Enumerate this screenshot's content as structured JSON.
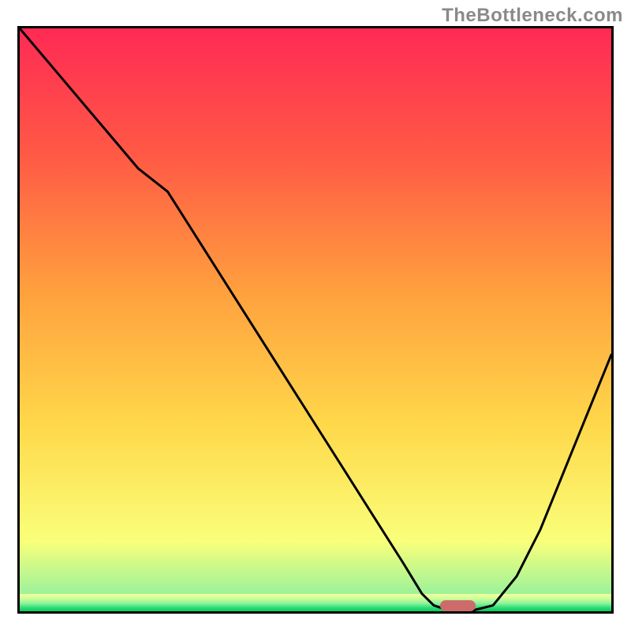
{
  "watermark": "TheBottleneck.com",
  "colors": {
    "border": "#000000",
    "curve": "#000000",
    "marker": "#cc6b6a",
    "gradient_top": "#ff2a55",
    "gradient_mid1": "#ff6a3e",
    "gradient_mid2": "#ffb73e",
    "gradient_mid3": "#ffe24a",
    "gradient_bottom": "#f7ff8a",
    "green": "#07c85a"
  },
  "chart_data": {
    "type": "line",
    "title": "",
    "xlabel": "",
    "ylabel": "",
    "xlim": [
      0,
      100
    ],
    "ylim": [
      0,
      100
    ],
    "series": [
      {
        "name": "bottleneck-curve",
        "x": [
          0,
          5,
          10,
          15,
          20,
          25,
          30,
          35,
          40,
          45,
          50,
          55,
          60,
          65,
          68,
          70,
          73,
          76,
          80,
          84,
          88,
          92,
          96,
          100
        ],
        "y": [
          100,
          94,
          88,
          82,
          76,
          72,
          64,
          56,
          48,
          40,
          32,
          24,
          16,
          8,
          3,
          1,
          0,
          0,
          1,
          6,
          14,
          24,
          34,
          44
        ]
      }
    ],
    "annotations": [
      {
        "name": "optimal-marker",
        "x": 74,
        "y": 1,
        "width_pct": 6,
        "color": "#cc6b6a"
      }
    ],
    "background": {
      "type": "vertical-gradient",
      "stops": [
        {
          "pos": 0.0,
          "color": "#ff2a55"
        },
        {
          "pos": 0.22,
          "color": "#ff5a45"
        },
        {
          "pos": 0.45,
          "color": "#ffa03e"
        },
        {
          "pos": 0.68,
          "color": "#ffd84a"
        },
        {
          "pos": 0.88,
          "color": "#f9ff7a"
        },
        {
          "pos": 0.97,
          "color": "#9cf29a"
        },
        {
          "pos": 1.0,
          "color": "#07c85a"
        }
      ]
    }
  }
}
